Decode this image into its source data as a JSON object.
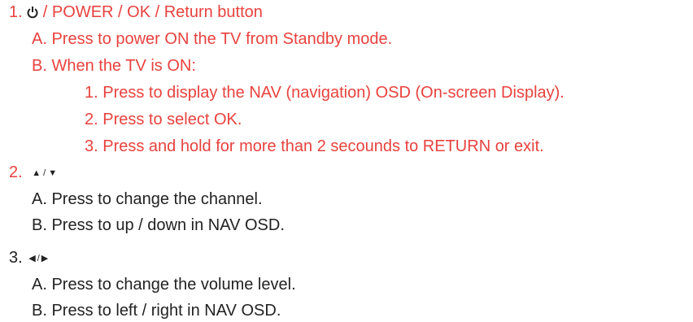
{
  "colors": {
    "red": "#e8423e",
    "black": "#222222"
  },
  "item1": {
    "number": "1.",
    "title": " / POWER / OK / Return button",
    "a": "A. Press to power ON the TV from Standby mode.",
    "b": "B. When the TV is ON:",
    "sub": [
      "1. Press to display the NAV (navigation) OSD (On-screen Display).",
      "2. Press to select OK.",
      "3. Press and hold for more than 2 secounds to RETURN or exit."
    ]
  },
  "item2": {
    "number": "2.",
    "up_icon": "▲",
    "slash": "/",
    "down_icon": "▼",
    "a": "A. Press to change the channel.",
    "b": "B. Press to up / down in NAV OSD."
  },
  "item3": {
    "number": "3.",
    "left_icon": "◀",
    "slash": "/",
    "right_icon": "▶",
    "a": "A. Press to change the volume level.",
    "b": "B. Press to left / right in NAV OSD."
  }
}
